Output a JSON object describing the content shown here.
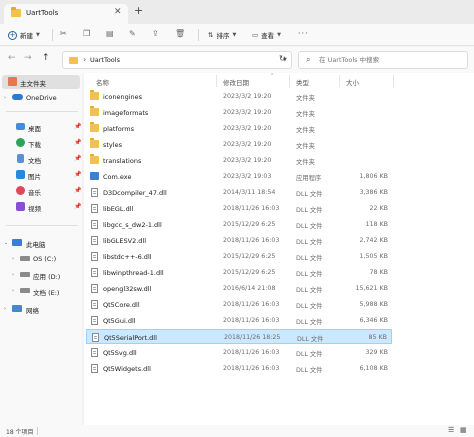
{
  "window": {
    "tab_title": "UartTools",
    "tab_close_icon": "close-icon",
    "new_tab_label": "+"
  },
  "toolbar": {
    "new_label": "新建",
    "sort_label": "排序",
    "view_label": "查看",
    "more_label": "···",
    "icons": [
      "cut-icon",
      "copy-icon",
      "paste-icon",
      "rename-icon",
      "share-icon",
      "delete-icon"
    ]
  },
  "address": {
    "back_icon": "←",
    "forward_icon": "→",
    "up_icon": "↑",
    "path": "UartTools",
    "refresh_icon": "↻"
  },
  "search": {
    "placeholder": "在 UartTools 中搜索"
  },
  "sidebar": {
    "items": [
      {
        "label": "主文件夹",
        "icon": "home-icon",
        "selected": true
      },
      {
        "label": "OneDrive",
        "icon": "cloud-icon",
        "expandable": true
      },
      {
        "label": "桌面",
        "icon": "desktop-icon",
        "pinned": true
      },
      {
        "label": "下载",
        "icon": "download-icon",
        "pinned": true
      },
      {
        "label": "文档",
        "icon": "document-icon",
        "pinned": true
      },
      {
        "label": "图片",
        "icon": "picture-icon",
        "pinned": true
      },
      {
        "label": "音乐",
        "icon": "music-icon",
        "pinned": true
      },
      {
        "label": "视频",
        "icon": "video-icon",
        "pinned": true
      },
      {
        "label": "此电脑",
        "icon": "computer-icon",
        "expandable": true,
        "expanded": true
      },
      {
        "label": "OS (C:)",
        "icon": "drive-icon",
        "expandable": true
      },
      {
        "label": "应用 (D:)",
        "icon": "drive-icon",
        "expandable": true
      },
      {
        "label": "文档 (E:)",
        "icon": "drive-icon",
        "expandable": true
      },
      {
        "label": "网络",
        "icon": "network-icon",
        "expandable": true
      }
    ]
  },
  "columns": {
    "name": "名称",
    "date": "修改日期",
    "type": "类型",
    "size": "大小"
  },
  "files": [
    {
      "name": "iconengines",
      "date": "2023/3/2 19:20",
      "type": "文件夹",
      "size": "",
      "kind": "folder"
    },
    {
      "name": "imageformats",
      "date": "2023/3/2 19:20",
      "type": "文件夹",
      "size": "",
      "kind": "folder"
    },
    {
      "name": "platforms",
      "date": "2023/3/2 19:20",
      "type": "文件夹",
      "size": "",
      "kind": "folder"
    },
    {
      "name": "styles",
      "date": "2023/3/2 19:20",
      "type": "文件夹",
      "size": "",
      "kind": "folder"
    },
    {
      "name": "translations",
      "date": "2023/3/2 19:20",
      "type": "文件夹",
      "size": "",
      "kind": "folder"
    },
    {
      "name": "Com.exe",
      "date": "2023/3/2 19:03",
      "type": "应用程序",
      "size": "1,806 KB",
      "kind": "exe"
    },
    {
      "name": "D3Dcompiler_47.dll",
      "date": "2014/3/11 18:54",
      "type": "DLL 文件",
      "size": "3,386 KB",
      "kind": "file"
    },
    {
      "name": "libEGL.dll",
      "date": "2018/11/26 16:03",
      "type": "DLL 文件",
      "size": "22 KB",
      "kind": "file"
    },
    {
      "name": "libgcc_s_dw2-1.dll",
      "date": "2015/12/29 6:25",
      "type": "DLL 文件",
      "size": "118 KB",
      "kind": "file"
    },
    {
      "name": "libGLESV2.dll",
      "date": "2018/11/26 16:03",
      "type": "DLL 文件",
      "size": "2,742 KB",
      "kind": "file"
    },
    {
      "name": "libstdc++-6.dll",
      "date": "2015/12/29 6:25",
      "type": "DLL 文件",
      "size": "1,505 KB",
      "kind": "file"
    },
    {
      "name": "libwinpthread-1.dll",
      "date": "2015/12/29 6:25",
      "type": "DLL 文件",
      "size": "78 KB",
      "kind": "file"
    },
    {
      "name": "opengl32sw.dll",
      "date": "2016/6/14 21:08",
      "type": "DLL 文件",
      "size": "15,621 KB",
      "kind": "file"
    },
    {
      "name": "Qt5Core.dll",
      "date": "2018/11/26 16:03",
      "type": "DLL 文件",
      "size": "5,988 KB",
      "kind": "file"
    },
    {
      "name": "Qt5Gui.dll",
      "date": "2018/11/26 16:03",
      "type": "DLL 文件",
      "size": "6,346 KB",
      "kind": "file"
    },
    {
      "name": "Qt5SerialPort.dll",
      "date": "2018/11/26 18:25",
      "type": "DLL 文件",
      "size": "85 KB",
      "kind": "file",
      "selected": true
    },
    {
      "name": "Qt5Svg.dll",
      "date": "2018/11/26 16:03",
      "type": "DLL 文件",
      "size": "329 KB",
      "kind": "file"
    },
    {
      "name": "Qt5Widgets.dll",
      "date": "2018/11/26 16:03",
      "type": "DLL 文件",
      "size": "6,108 KB",
      "kind": "file"
    }
  ],
  "status": {
    "item_count": "18 个项目"
  },
  "colors": {
    "folder": "#f2c14e",
    "selection": "#cce8ff",
    "accent": "#1f5fa8"
  }
}
